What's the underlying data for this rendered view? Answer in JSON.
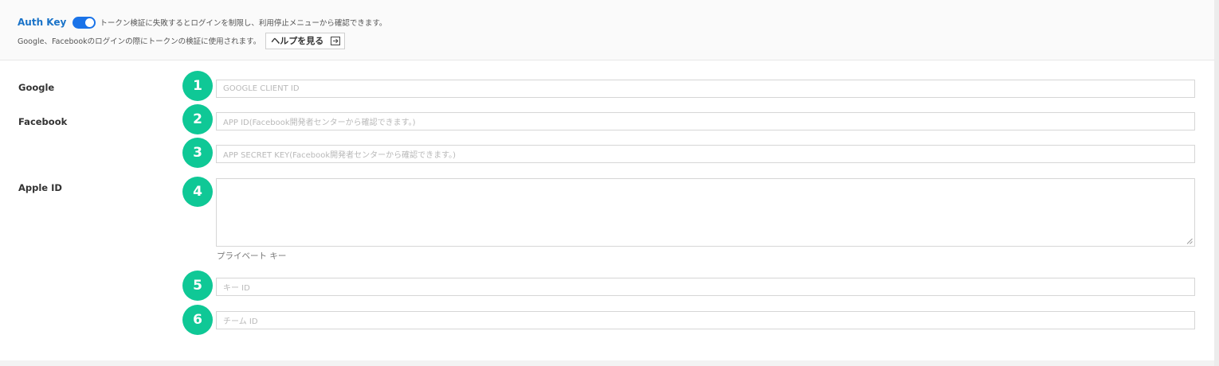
{
  "header": {
    "title": "Auth Key",
    "toggle_on": true,
    "description_line1": "トークン検証に失敗するとログインを制限し、利用停止メニューから確認できます。",
    "description_line2": "Google、Facebookのログインの際にトークンの検証に使用されます。",
    "help_button_label": "ヘルプを見る",
    "help_icon": "external-link-icon"
  },
  "colors": {
    "accent": "#1a73c8",
    "toggle": "#1a73e8",
    "badge": "#0fc896"
  },
  "sections": {
    "google": {
      "label": "Google"
    },
    "facebook": {
      "label": "Facebook"
    },
    "apple": {
      "label": "Apple ID",
      "private_key_caption": "プライベート キー"
    }
  },
  "fields": [
    {
      "badge": "1",
      "placeholder": "GOOGLE CLIENT ID",
      "value": ""
    },
    {
      "badge": "2",
      "placeholder": "APP ID(Facebook開発者センターから確認できます。)",
      "value": ""
    },
    {
      "badge": "3",
      "placeholder": "APP SECRET KEY(Facebook開発者センターから確認できます。)",
      "value": ""
    },
    {
      "badge": "4",
      "placeholder": "",
      "value": ""
    },
    {
      "badge": "5",
      "placeholder": "キー ID",
      "value": ""
    },
    {
      "badge": "6",
      "placeholder": "チーム ID",
      "value": ""
    }
  ]
}
